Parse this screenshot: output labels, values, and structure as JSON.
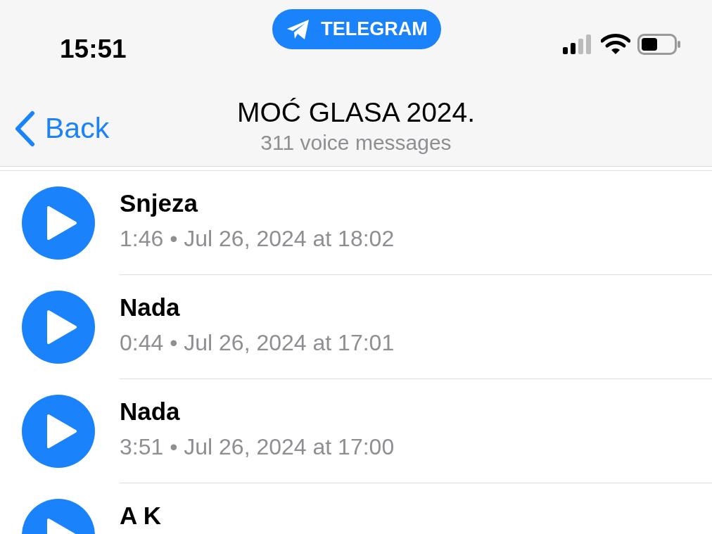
{
  "status_bar": {
    "time": "15:51",
    "app_badge": "TELEGRAM"
  },
  "nav": {
    "back": "Back",
    "title": "MOĆ GLASA 2024.",
    "subtitle": "311 voice messages"
  },
  "messages": [
    {
      "sender": "Snjeza",
      "info": "1:46 • Jul 26, 2024 at 18:02"
    },
    {
      "sender": "Nada",
      "info": "0:44 • Jul 26, 2024 at 17:01"
    },
    {
      "sender": "Nada",
      "info": "3:51 • Jul 26, 2024 at 17:00"
    },
    {
      "sender": "A K"
    }
  ]
}
